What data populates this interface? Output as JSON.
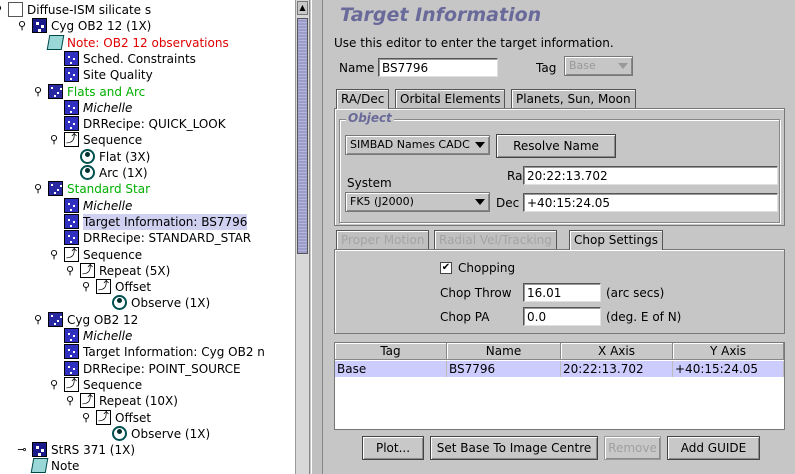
{
  "tree": {
    "nodes": [
      {
        "label": "Diffuse-ISM silicate s",
        "icon": "program-icon",
        "color": "",
        "style": ""
      },
      {
        "label": "Cyg OB2 12 (1X)",
        "icon": "observation-icon",
        "color": "",
        "style": ""
      },
      {
        "label": "Note: OB2 12 observations",
        "icon": "note-icon",
        "color": "red",
        "style": ""
      },
      {
        "label": "Sched. Constraints",
        "icon": "component-icon",
        "color": "",
        "style": ""
      },
      {
        "label": "Site Quality",
        "icon": "component-icon",
        "color": "",
        "style": ""
      },
      {
        "label": "Flats and Arc",
        "icon": "folder-icon",
        "color": "green",
        "style": ""
      },
      {
        "label": "Michelle",
        "icon": "component-icon",
        "color": "",
        "style": "italic"
      },
      {
        "label": "DRRecipe: QUICK_LOOK",
        "icon": "component-icon",
        "color": "",
        "style": ""
      },
      {
        "label": "Sequence",
        "icon": "sequence-icon",
        "color": "",
        "style": ""
      },
      {
        "label": "Flat (3X)",
        "icon": "eye-icon",
        "color": "",
        "style": ""
      },
      {
        "label": "Arc (1X)",
        "icon": "eye-icon",
        "color": "",
        "style": ""
      },
      {
        "label": "Standard Star",
        "icon": "folder-icon",
        "color": "green",
        "style": ""
      },
      {
        "label": "Michelle",
        "icon": "component-icon",
        "color": "",
        "style": "italic"
      },
      {
        "label": "Target Information: BS7796",
        "icon": "component-icon",
        "color": "",
        "style": "selected"
      },
      {
        "label": "DRRecipe: STANDARD_STAR",
        "icon": "component-icon",
        "color": "",
        "style": ""
      },
      {
        "label": "Sequence",
        "icon": "sequence-icon",
        "color": "",
        "style": ""
      },
      {
        "label": "Repeat (5X)",
        "icon": "iterator-icon",
        "color": "",
        "style": ""
      },
      {
        "label": "Offset",
        "icon": "iterator-icon",
        "color": "",
        "style": ""
      },
      {
        "label": "Observe (1X)",
        "icon": "eye-icon",
        "color": "",
        "style": ""
      },
      {
        "label": "Cyg OB2 12",
        "icon": "folder-icon",
        "color": "",
        "style": ""
      },
      {
        "label": "Michelle",
        "icon": "component-icon",
        "color": "",
        "style": "italic"
      },
      {
        "label": "Target Information: Cyg OB2 n",
        "icon": "component-icon",
        "color": "",
        "style": ""
      },
      {
        "label": "DRRecipe: POINT_SOURCE",
        "icon": "component-icon",
        "color": "",
        "style": ""
      },
      {
        "label": "Sequence",
        "icon": "sequence-icon",
        "color": "",
        "style": ""
      },
      {
        "label": "Repeat (10X)",
        "icon": "iterator-icon",
        "color": "",
        "style": ""
      },
      {
        "label": "Offset",
        "icon": "iterator-icon",
        "color": "",
        "style": ""
      },
      {
        "label": "Observe (1X)",
        "icon": "eye-icon",
        "color": "",
        "style": ""
      },
      {
        "label": "StRS 371 (1X)",
        "icon": "observation-icon",
        "color": "",
        "style": ""
      },
      {
        "label": "Note",
        "icon": "note-icon",
        "color": "",
        "style": ""
      }
    ]
  },
  "editor": {
    "title": "Target Information",
    "description": "Use this editor to enter the target information.",
    "name_label": "Name",
    "name_value": "BS7796",
    "tag_label": "Tag",
    "tag_value": "Base",
    "tabs": [
      "RA/Dec",
      "Orbital Elements",
      "Planets, Sun, Moon"
    ],
    "object": {
      "group_title": "Object",
      "catalog": "SIMBAD Names CADC",
      "resolve_button": "Resolve Name",
      "system_label": "System",
      "system_value": "FK5 (J2000)",
      "ra_label": "Ra",
      "ra_value": "20:22:13.702",
      "dec_label": "Dec",
      "dec_value": "+40:15:24.05"
    },
    "subtabs": [
      "Proper Motion",
      "Radial Vel/Tracking",
      "Chop Settings"
    ],
    "chop": {
      "chopping_label": "Chopping",
      "chopping_checked": "✔",
      "throw_label": "Chop Throw",
      "throw_value": "16.01",
      "throw_unit": "(arc secs)",
      "pa_label": "Chop PA",
      "pa_value": "0.0",
      "pa_unit": "(deg. E of N)"
    },
    "table": {
      "headers": [
        "Tag",
        "Name",
        "X Axis",
        "Y Axis"
      ],
      "rows": [
        [
          "Base",
          "BS7796",
          "20:22:13.702",
          "+40:15:24.05"
        ]
      ]
    },
    "buttons": {
      "plot": "Plot...",
      "set_base": "Set Base To Image Centre",
      "remove": "Remove",
      "add_guide": "Add GUIDE"
    }
  }
}
